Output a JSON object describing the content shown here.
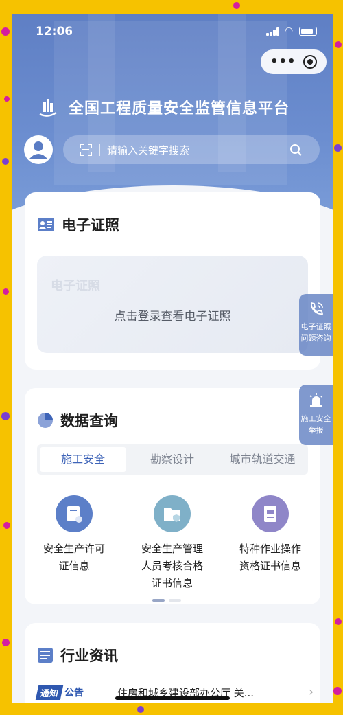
{
  "status_bar": {
    "time": "12:06"
  },
  "capsule": {
    "more_icon": "more-dots-icon",
    "close_icon": "target-circle-icon"
  },
  "header": {
    "title": "全国工程质量安全监管信息平台",
    "search_placeholder": "请输入关键字搜索"
  },
  "license_card": {
    "title": "电子证照",
    "watermark": "电子证照",
    "message": "点击登录查看电子证照"
  },
  "data_query": {
    "title": "数据查询",
    "tabs": [
      "施工安全",
      "勘察设计",
      "城市轨道交通"
    ],
    "active_tab": 0,
    "items": [
      {
        "label_lines": [
          "安全生产许可",
          "证信息"
        ],
        "icon": "certificate-icon",
        "color": "#5c7fc8"
      },
      {
        "label_lines": [
          "安全生产管理",
          "人员考核合格",
          "证书信息"
        ],
        "icon": "folder-shield-icon",
        "color": "#7fb0c8"
      },
      {
        "label_lines": [
          "特种作业操作",
          "资格证书信息"
        ],
        "icon": "document-card-icon",
        "color": "#8f86c8"
      }
    ],
    "page_index": 0,
    "page_count": 2
  },
  "side_buttons": [
    {
      "lines": [
        "电子证照",
        "问题咨询"
      ],
      "icon": "phone-call-icon"
    },
    {
      "lines": [
        "施工安全",
        "举报"
      ],
      "icon": "alarm-light-icon"
    }
  ],
  "news": {
    "title": "行业资讯",
    "tag_a": "通知",
    "tag_b": "公告",
    "headline": "住房和城乡建设部办公厅 关..."
  },
  "colors": {
    "accent": "#3e64b8",
    "hero": "#6a8bce"
  }
}
